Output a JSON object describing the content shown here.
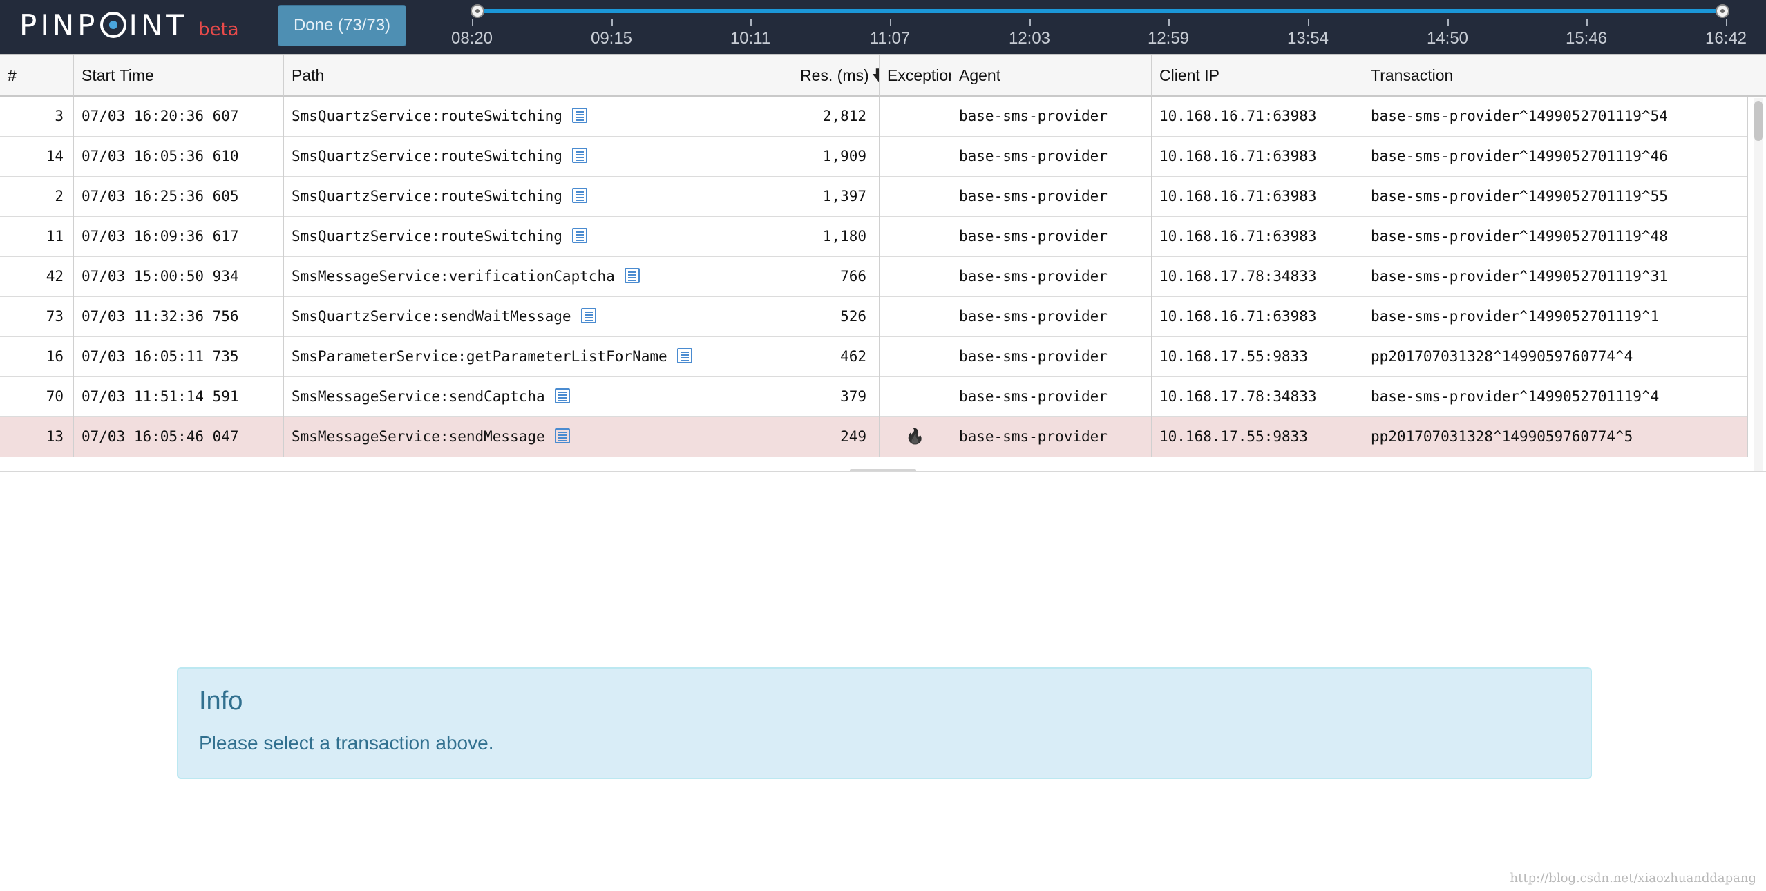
{
  "brand": {
    "name_part1": "PINP",
    "name_part2": "INT",
    "beta": "beta"
  },
  "toolbar": {
    "done_label": "Done (73/73)"
  },
  "timeline": {
    "labels": [
      "08:20",
      "09:15",
      "10:11",
      "11:07",
      "12:03",
      "12:59",
      "13:54",
      "14:50",
      "15:46",
      "16:42"
    ],
    "accent_color": "#1b97d8"
  },
  "grid": {
    "columns": [
      "#",
      "Start Time",
      "Path",
      "Res. (ms)",
      "Exception",
      "Agent",
      "Client IP",
      "Transaction"
    ],
    "sort_column": "Res. (ms)",
    "sort_direction": "descending",
    "rows": [
      {
        "idx": "3",
        "start": "07/03 16:20:36 607",
        "path": "SmsQuartzService:routeSwitching",
        "res": "2,812",
        "exception": "",
        "agent": "base-sms-provider",
        "ip": "10.168.16.71:63983",
        "tx": "base-sms-provider^1499052701119^54"
      },
      {
        "idx": "14",
        "start": "07/03 16:05:36 610",
        "path": "SmsQuartzService:routeSwitching",
        "res": "1,909",
        "exception": "",
        "agent": "base-sms-provider",
        "ip": "10.168.16.71:63983",
        "tx": "base-sms-provider^1499052701119^46"
      },
      {
        "idx": "2",
        "start": "07/03 16:25:36 605",
        "path": "SmsQuartzService:routeSwitching",
        "res": "1,397",
        "exception": "",
        "agent": "base-sms-provider",
        "ip": "10.168.16.71:63983",
        "tx": "base-sms-provider^1499052701119^55"
      },
      {
        "idx": "11",
        "start": "07/03 16:09:36 617",
        "path": "SmsQuartzService:routeSwitching",
        "res": "1,180",
        "exception": "",
        "agent": "base-sms-provider",
        "ip": "10.168.16.71:63983",
        "tx": "base-sms-provider^1499052701119^48"
      },
      {
        "idx": "42",
        "start": "07/03 15:00:50 934",
        "path": "SmsMessageService:verificationCaptcha",
        "res": "766",
        "exception": "",
        "agent": "base-sms-provider",
        "ip": "10.168.17.78:34833",
        "tx": "base-sms-provider^1499052701119^31"
      },
      {
        "idx": "73",
        "start": "07/03 11:32:36 756",
        "path": "SmsQuartzService:sendWaitMessage",
        "res": "526",
        "exception": "",
        "agent": "base-sms-provider",
        "ip": "10.168.16.71:63983",
        "tx": "base-sms-provider^1499052701119^1"
      },
      {
        "idx": "16",
        "start": "07/03 16:05:11 735",
        "path": "SmsParameterService:getParameterListForName",
        "res": "462",
        "exception": "",
        "agent": "base-sms-provider",
        "ip": "10.168.17.55:9833",
        "tx": "pp201707031328^1499059760774^4"
      },
      {
        "idx": "70",
        "start": "07/03 11:51:14 591",
        "path": "SmsMessageService:sendCaptcha",
        "res": "379",
        "exception": "",
        "agent": "base-sms-provider",
        "ip": "10.168.17.78:34833",
        "tx": "base-sms-provider^1499052701119^4"
      },
      {
        "idx": "13",
        "start": "07/03 16:05:46 047",
        "path": "SmsMessageService:sendMessage",
        "res": "249",
        "exception": "fire-icon",
        "agent": "base-sms-provider",
        "ip": "10.168.17.55:9833",
        "tx": "pp201707031328^1499059760774^5",
        "highlight": true
      }
    ]
  },
  "info": {
    "title": "Info",
    "message": "Please select a transaction above."
  },
  "watermark": "http://blog.csdn.net/xiaozhuanddapang"
}
